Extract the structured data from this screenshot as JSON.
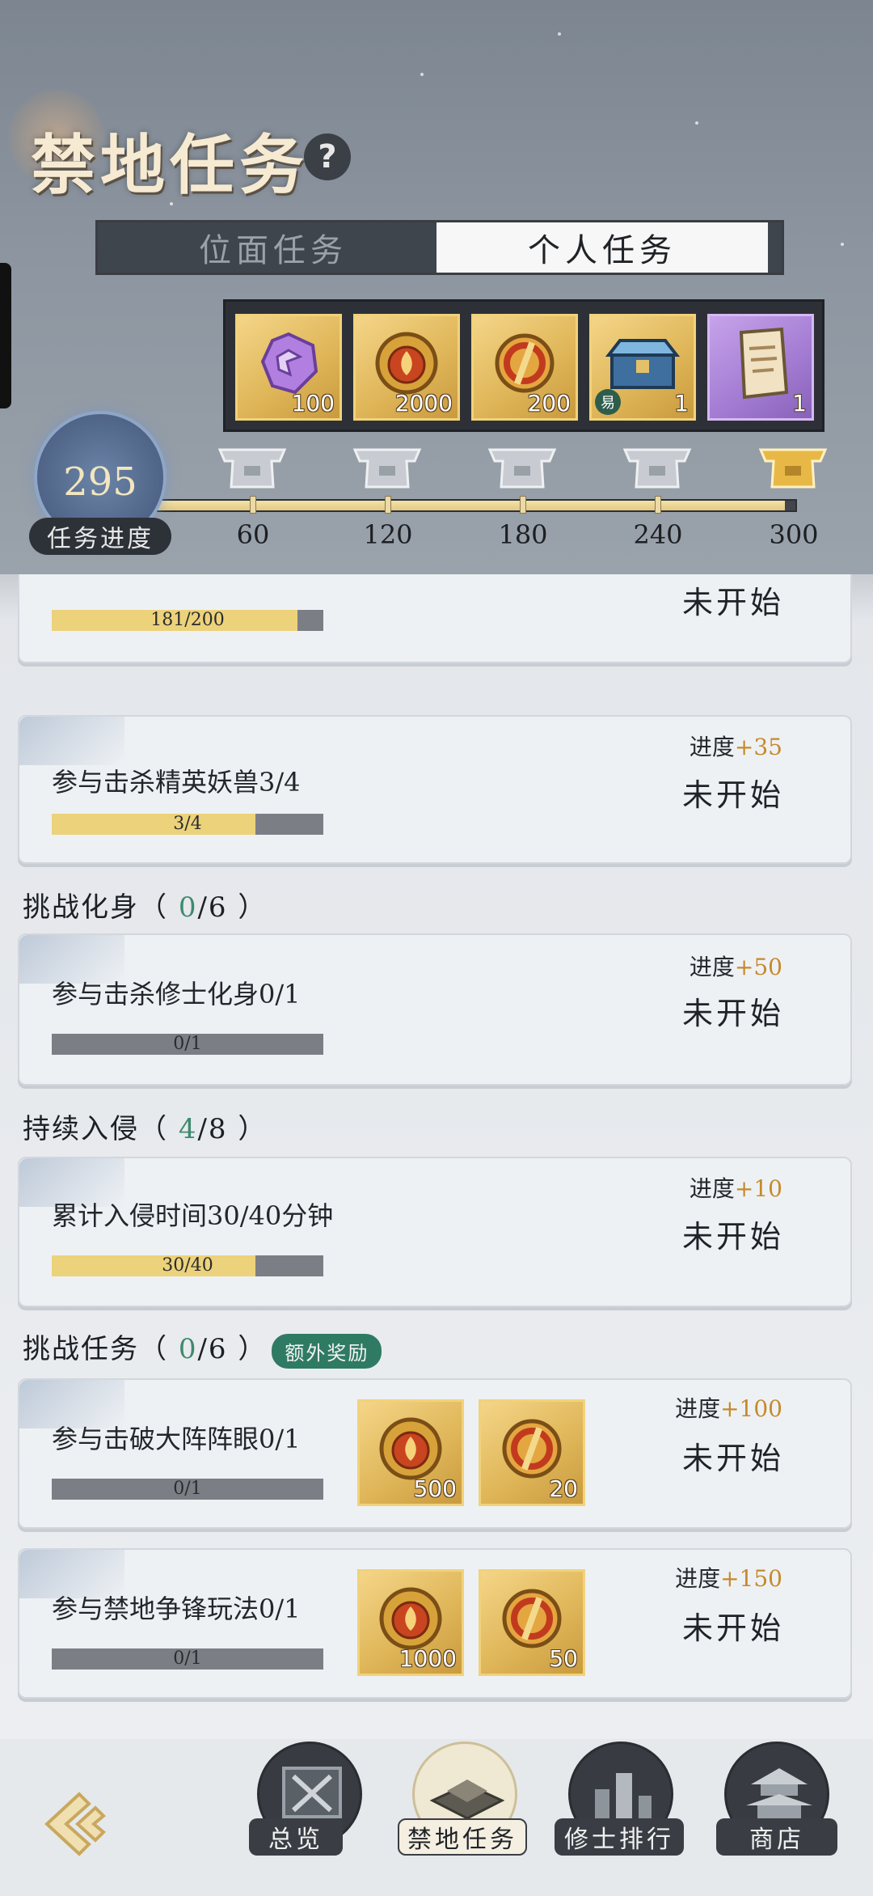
{
  "header": {
    "title": "禁地任务",
    "help_icon": "?"
  },
  "tabs": [
    {
      "label": "位面任务",
      "active": false
    },
    {
      "label": "个人任务",
      "active": true
    }
  ],
  "rewards": [
    {
      "icon": "purple-c-gem-icon",
      "qty": "100",
      "style": "gold"
    },
    {
      "icon": "fire-dragon-coin-icon",
      "qty": "2000",
      "style": "gold"
    },
    {
      "icon": "red-jade-medal-icon",
      "qty": "200",
      "style": "gold"
    },
    {
      "icon": "treasure-chest-icon",
      "qty": "1",
      "badge": "易",
      "style": "gold"
    },
    {
      "icon": "scroll-icon",
      "qty": "1",
      "style": "purple"
    }
  ],
  "progress": {
    "label": "任务进度",
    "value": "295",
    "current": 295,
    "max": 300,
    "milestones": [
      "60",
      "120",
      "180",
      "240",
      "300"
    ]
  },
  "partial_card": {
    "status": "未开始",
    "bar_text": "181/200",
    "fraction": 0.905
  },
  "cards_top": [
    {
      "name": "参与击杀精英妖兽3/4",
      "bar_text": "3/4",
      "fraction": 0.75,
      "progress_label": "进度",
      "progress_plus": "+35",
      "status": "未开始"
    }
  ],
  "sections": [
    {
      "name": "挑战化身",
      "done": "0",
      "total": "6",
      "tasks": [
        {
          "name": "参与击杀修士化身0/1",
          "bar_text": "0/1",
          "fraction": 0,
          "progress_label": "进度",
          "progress_plus": "+50",
          "status": "未开始"
        }
      ]
    },
    {
      "name": "持续入侵",
      "done": "4",
      "total": "8",
      "tasks": [
        {
          "name": "累计入侵时间30/40分钟",
          "bar_text": "30/40",
          "fraction": 0.75,
          "progress_label": "进度",
          "progress_plus": "+10",
          "status": "未开始"
        }
      ]
    },
    {
      "name": "挑战任务",
      "done": "0",
      "total": "6",
      "badge": "额外奖励",
      "tasks": [
        {
          "name": "参与击破大阵阵眼0/1",
          "bar_text": "0/1",
          "fraction": 0,
          "progress_label": "进度",
          "progress_plus": "+100",
          "status": "未开始",
          "rewards": [
            {
              "icon": "fire-dragon-coin-icon",
              "qty": "500"
            },
            {
              "icon": "red-jade-medal-icon",
              "qty": "20"
            }
          ]
        },
        {
          "name": "参与禁地争锋玩法0/1",
          "bar_text": "0/1",
          "fraction": 0,
          "progress_label": "进度",
          "progress_plus": "+150",
          "status": "未开始",
          "rewards": [
            {
              "icon": "fire-dragon-coin-icon",
              "qty": "1000"
            },
            {
              "icon": "red-jade-medal-icon",
              "qty": "50"
            }
          ]
        }
      ]
    }
  ],
  "nav": {
    "back_icon": "back-arrow-icon",
    "items": [
      {
        "label": "总览",
        "icon": "crossed-swords-scroll-icon",
        "active": false
      },
      {
        "label": "禁地任务",
        "icon": "book-icon",
        "active": true
      },
      {
        "label": "修士排行",
        "icon": "ranking-icon",
        "active": false
      },
      {
        "label": "商店",
        "icon": "pagoda-icon",
        "active": false
      }
    ]
  },
  "colors": {
    "accent_gold": "#ecd27a",
    "progress_plus": "#c58a2b",
    "section_done": "#3e8a6d",
    "badge": "#2f7a63"
  }
}
